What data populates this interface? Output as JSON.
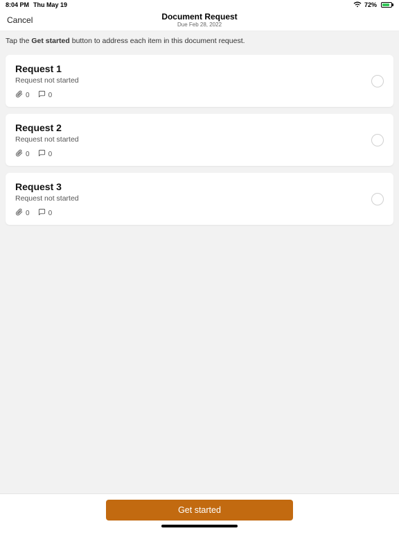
{
  "status": {
    "time": "8:04 PM",
    "date": "Thu May 19",
    "battery_pct": "72%"
  },
  "nav": {
    "cancel": "Cancel",
    "title": "Document Request",
    "subtitle": "Due Feb 28, 2022"
  },
  "instruction": {
    "pre": "Tap the ",
    "bold": "Get started",
    "post": " button to address each item in this document request."
  },
  "requests": [
    {
      "title": "Request 1",
      "status": "Request not started",
      "attachments": "0",
      "comments": "0"
    },
    {
      "title": "Request 2",
      "status": "Request not started",
      "attachments": "0",
      "comments": "0"
    },
    {
      "title": "Request 3",
      "status": "Request not started",
      "attachments": "0",
      "comments": "0"
    }
  ],
  "footer": {
    "primary": "Get started"
  }
}
